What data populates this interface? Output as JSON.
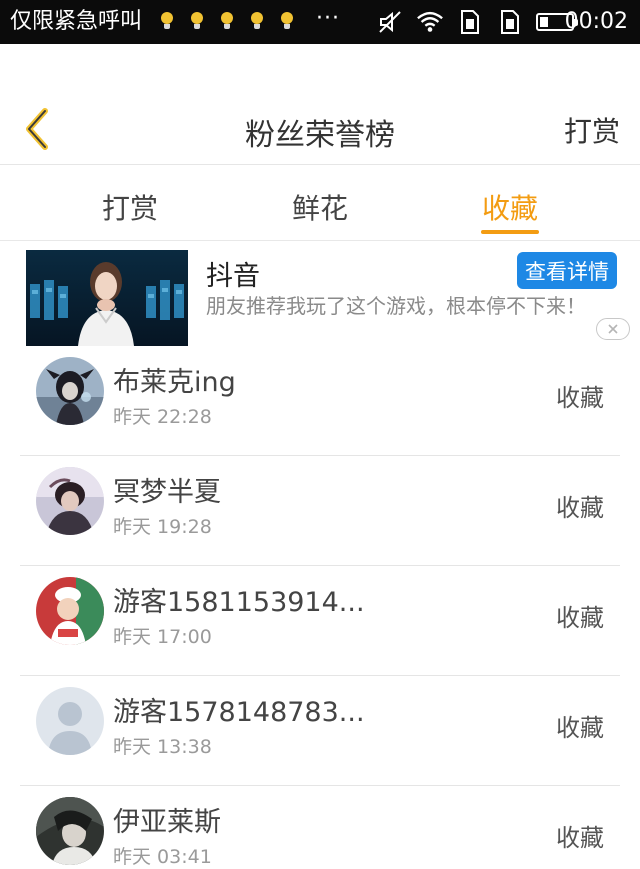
{
  "status_bar": {
    "carrier": "仅限紧急呼叫",
    "more": "···",
    "time": "00:02",
    "icons": [
      "lightbulb-icon",
      "lightbulb-icon",
      "lightbulb-icon",
      "lightbulb-icon",
      "lightbulb-icon",
      "mute-icon",
      "wifi-icon",
      "sim-icon",
      "sim-icon",
      "battery-icon"
    ]
  },
  "header": {
    "back_icon": "chevron-left-icon",
    "title": "粉丝荣誉榜",
    "right_action": "打赏",
    "accent_color": "#f39c12"
  },
  "tabs": [
    {
      "label": "打赏",
      "active": false
    },
    {
      "label": "鲜花",
      "active": false
    },
    {
      "label": "收藏",
      "active": true
    }
  ],
  "ad": {
    "title": "抖音",
    "button": "查看详情",
    "description": "朋友推荐我玩了这个游戏，根本停不下来！",
    "close_icon": "close-icon",
    "button_color": "#1e88e5"
  },
  "fans": [
    {
      "name": "布莱克ing",
      "time": "昨天 22:28",
      "action": "收藏"
    },
    {
      "name": "冥梦半夏",
      "time": "昨天 19:28",
      "action": "收藏"
    },
    {
      "name": "游客1581153914...",
      "time": "昨天 17:00",
      "action": "收藏"
    },
    {
      "name": "游客1578148783...",
      "time": "昨天 13:38",
      "action": "收藏"
    },
    {
      "name": "伊亚莱斯",
      "time": "昨天 03:41",
      "action": "收藏"
    }
  ]
}
